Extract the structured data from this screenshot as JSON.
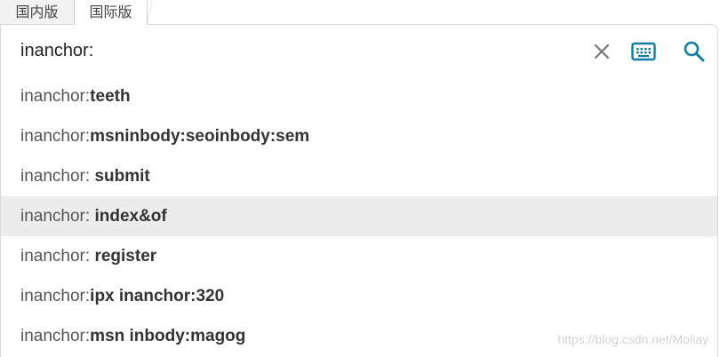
{
  "tabs": [
    {
      "label": "国内版",
      "active": false
    },
    {
      "label": "国际版",
      "active": true
    }
  ],
  "search": {
    "value": "inanchor:",
    "placeholder": ""
  },
  "icons": {
    "clear": "close-icon",
    "keyboard": "keyboard-icon",
    "search": "search-icon"
  },
  "colors": {
    "accent": "#0f7ea0",
    "clear_icon": "#777777",
    "highlight_bg": "#ececec"
  },
  "suggestions": [
    {
      "prefix": "inanchor:",
      "completion": "teeth"
    },
    {
      "prefix": "inanchor:",
      "completion": "msninbody:seoinbody:sem"
    },
    {
      "prefix": "inanchor: ",
      "completion": "submit"
    },
    {
      "prefix": "inanchor: ",
      "completion": "index&of",
      "highlighted": true
    },
    {
      "prefix": "inanchor: ",
      "completion": "register"
    },
    {
      "prefix": "inanchor:",
      "completion": "ipx inanchor:320"
    },
    {
      "prefix": "inanchor:",
      "completion": "msn inbody:magog"
    }
  ],
  "watermark": "https://blog.csdn.net/Moliay"
}
